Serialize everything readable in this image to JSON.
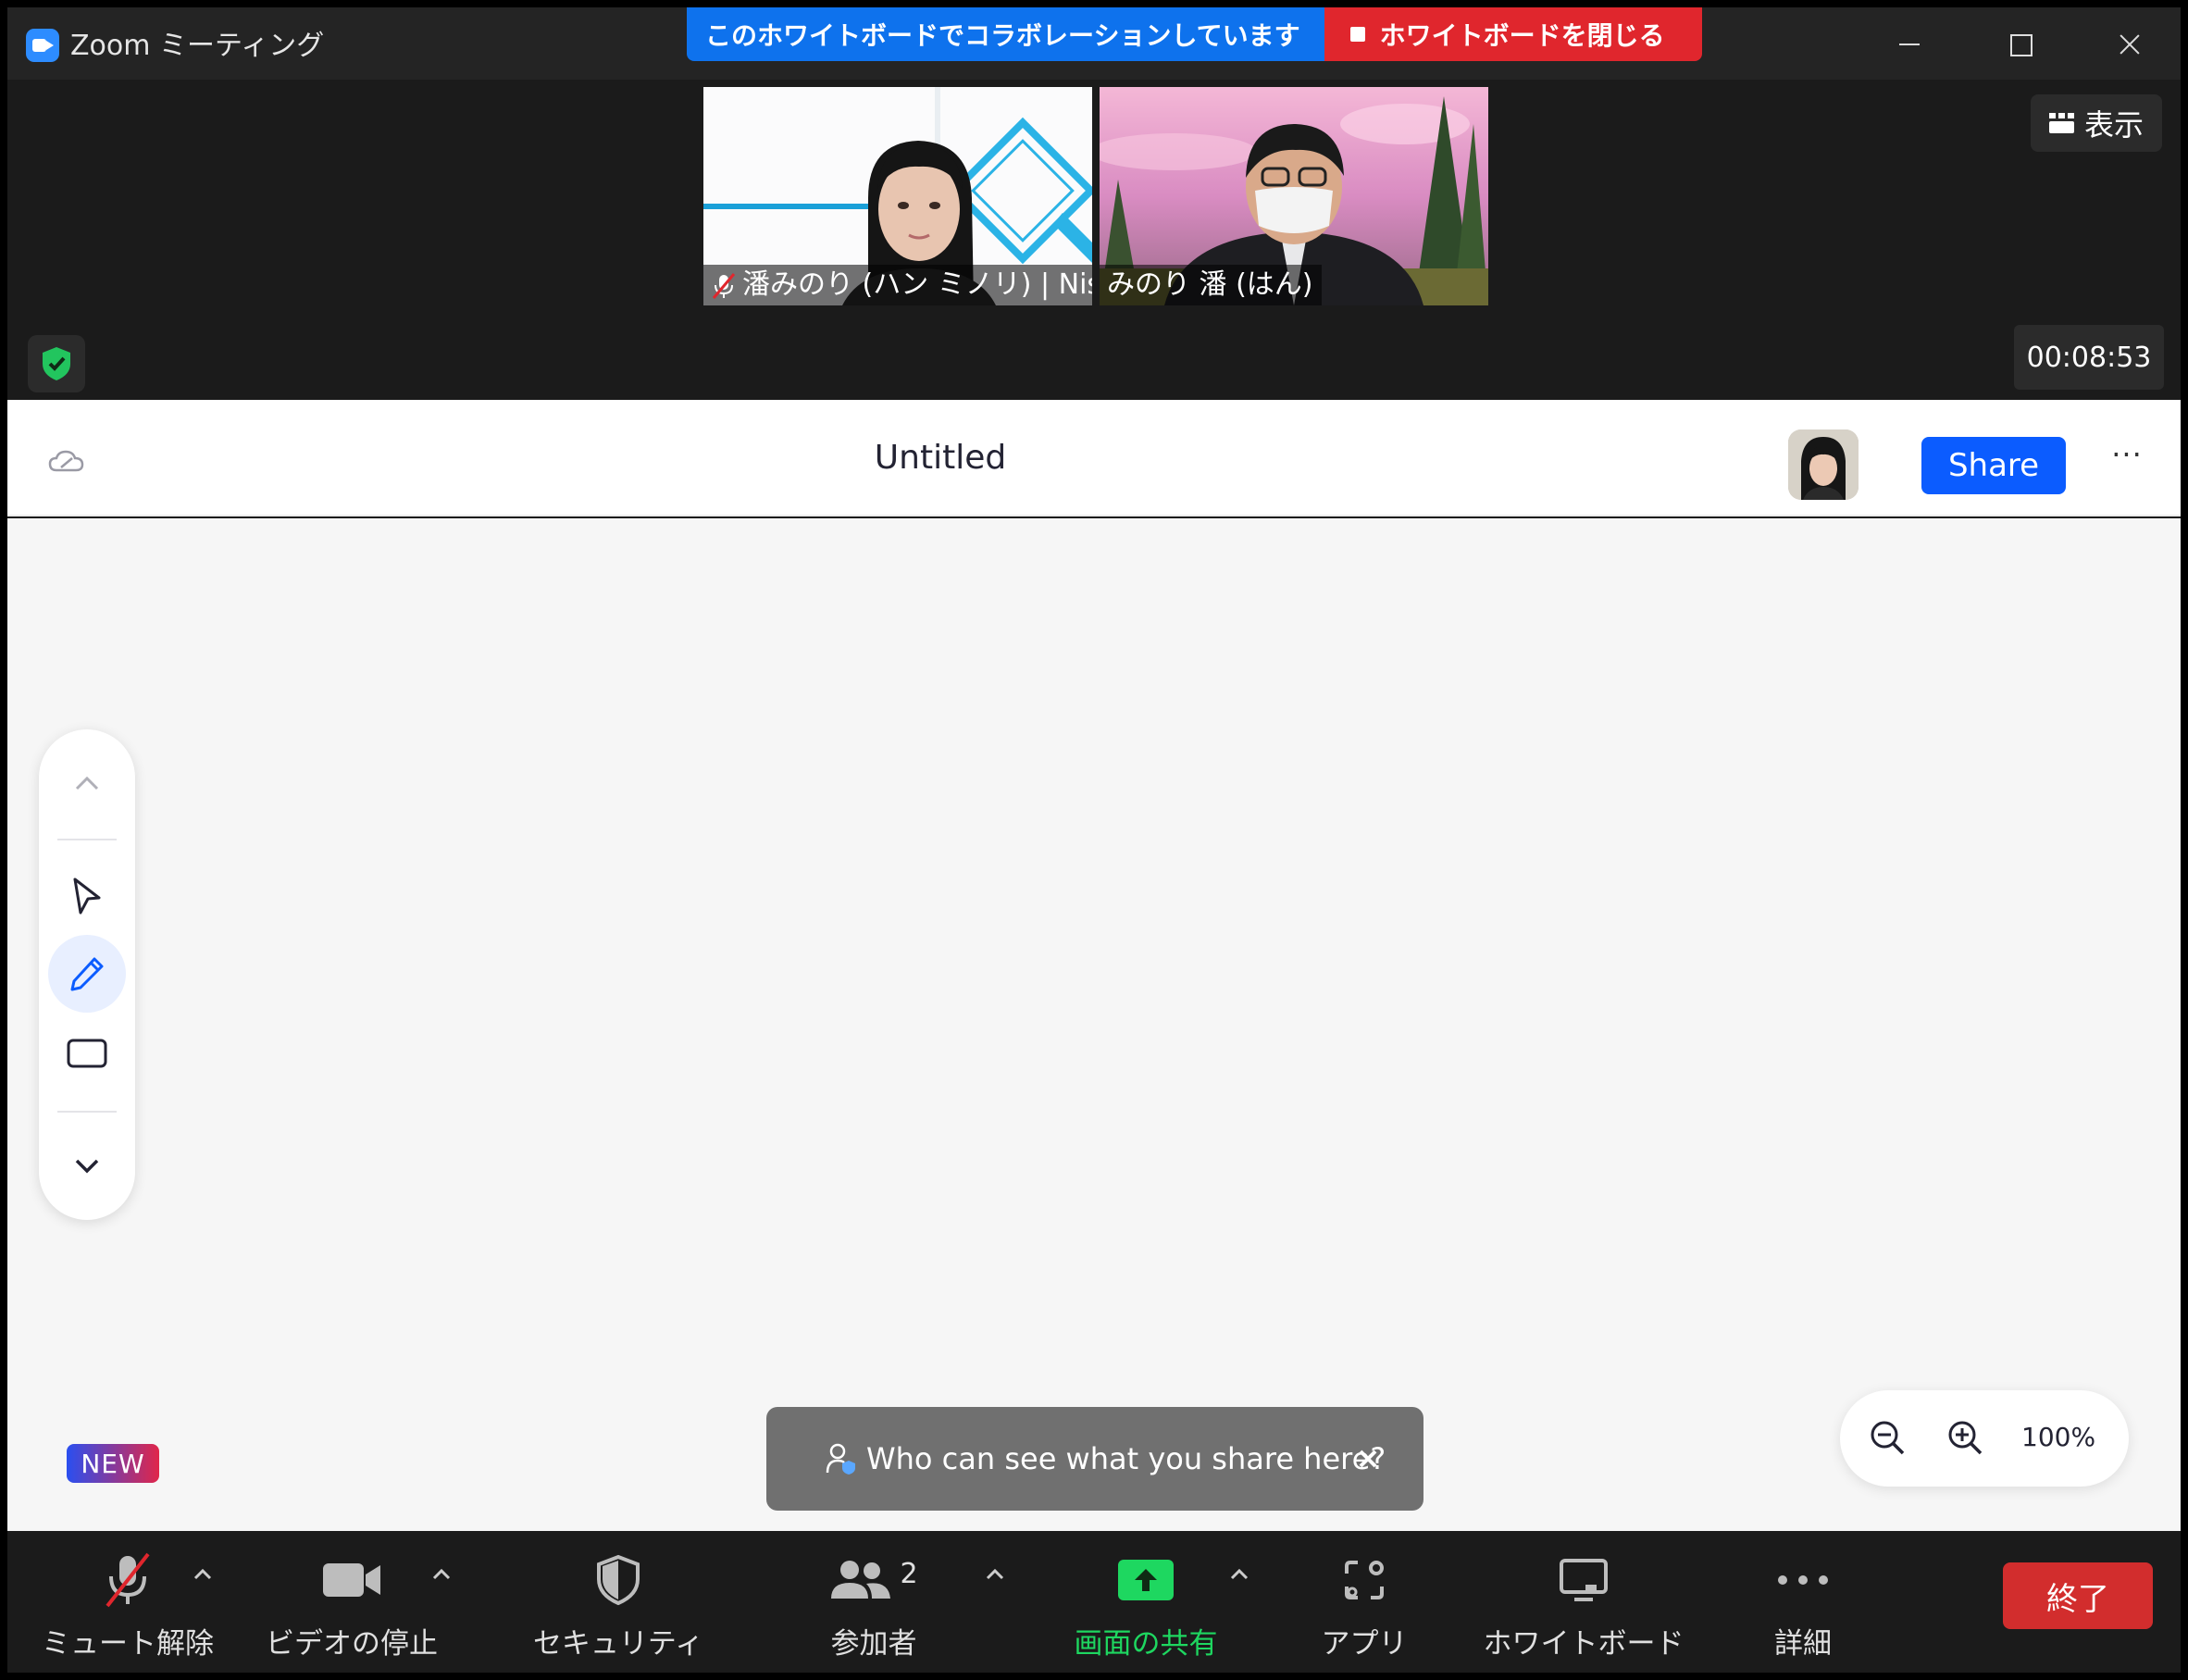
{
  "window": {
    "title": "Zoom ミーティング"
  },
  "banner": {
    "collab_text": "このホワイトボードでコラボレーションしています",
    "close_label": "ホワイトボードを閉じる"
  },
  "video": {
    "participants": [
      {
        "name": "潘みのり (ハン ミノリ) | Nissho",
        "muted": true
      },
      {
        "name": "みのり 潘 (はん)",
        "muted": false
      }
    ],
    "view_label": "表示",
    "timer": "00:08:53"
  },
  "whiteboard": {
    "title": "Untitled",
    "share_label": "Share",
    "more_label": "···",
    "new_badge": "NEW",
    "toast_text": "Who can see what you share here?",
    "zoom_level": "100%",
    "tools": [
      "select",
      "pen",
      "rectangle"
    ],
    "active_tool": "pen"
  },
  "toolbar": {
    "mute": "ミュート解除",
    "video": "ビデオの停止",
    "security": "セキュリティ",
    "participants": "参加者",
    "participants_count": "2",
    "share_screen": "画面の共有",
    "apps": "アプリ",
    "whiteboard": "ホワイトボード",
    "more": "詳細",
    "end": "終了"
  },
  "colors": {
    "accent": "#0b5cff",
    "share_green": "#1ed760",
    "end_red": "#d22d2d",
    "banner_blue": "#0e72ed",
    "banner_red": "#e0262d"
  }
}
